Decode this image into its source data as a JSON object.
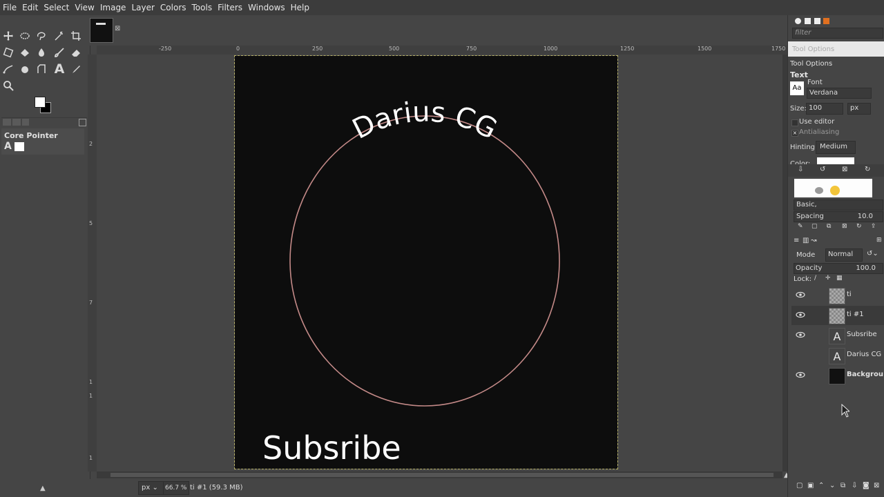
{
  "menubar": {
    "items": [
      "File",
      "Edit",
      "Select",
      "View",
      "Image",
      "Layer",
      "Colors",
      "Tools",
      "Filters",
      "Windows",
      "Help"
    ]
  },
  "toolbox": {
    "tools": [
      "move-tool-icon",
      "rect-select-icon",
      "lasso-icon",
      "fuzzy-select-icon",
      "crop-icon",
      "transform-icon",
      "bucket-fill-icon",
      "paint-icon",
      "paintbrush-icon",
      "eraser-icon",
      "path-icon",
      "smudge-icon",
      "clone-icon",
      "text-tool-icon",
      "color-picker-icon",
      "zoom-icon"
    ],
    "device_panel": {
      "title": "Core Pointer"
    }
  },
  "rulers": {
    "h_ticks": [
      "-250",
      "0",
      "250",
      "500",
      "750",
      "1000",
      "1250",
      "1500",
      "1750"
    ],
    "v_ticks": [
      "2",
      "5",
      "7",
      "1",
      "1",
      "1"
    ]
  },
  "canvas": {
    "image_bg": "#0d0d0d",
    "circle_stroke": "#c48a88",
    "arc_text": "Darius CG",
    "bottom_text": "Subsribe"
  },
  "statusbar": {
    "unit": "px",
    "zoom": "66.7 %",
    "info": "ti #1 (59.3 MB)"
  },
  "dock": {
    "filter_placeholder": "filter",
    "tool_options_tab": "Tool Options",
    "tool_options_header": "Tool Options",
    "section": "Text",
    "font_label": "Font",
    "font_value": "Verdana",
    "size_label": "Size:",
    "size_value": "100",
    "size_unit": "px",
    "use_editor": "Use editor",
    "antialiasing": "Antialiasing",
    "hinting_label": "Hinting:",
    "hinting_value": "Medium",
    "color_label": "Color:",
    "brush_set": "Basic,",
    "spacing_label": "Spacing",
    "spacing_value": "10.0",
    "mode_label": "Mode",
    "mode_value": "Normal",
    "opacity_label": "Opacity",
    "opacity_value": "100.0",
    "lock_label": "Lock:"
  },
  "layers": [
    {
      "name": "ti",
      "visible": true,
      "thumb": "checker",
      "bold": false
    },
    {
      "name": "ti #1",
      "visible": true,
      "thumb": "checker",
      "bold": false
    },
    {
      "name": "Subsribe",
      "visible": true,
      "thumb": "text",
      "bold": false
    },
    {
      "name": "Darius CG",
      "visible": false,
      "thumb": "text",
      "bold": false
    },
    {
      "name": "Backgrou",
      "visible": true,
      "thumb": "dark",
      "bold": true
    }
  ]
}
